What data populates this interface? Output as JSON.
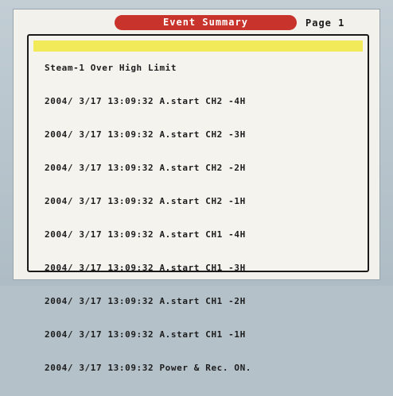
{
  "header": {
    "title": "Event Summary",
    "page_label": "Page 1"
  },
  "events": {
    "highlighted": "Steam-1 Over High Limit",
    "rows": [
      "2004/ 3/17 13:09:32 A.start CH2 -4H",
      "2004/ 3/17 13:09:32 A.start CH2 -3H",
      "2004/ 3/17 13:09:32 A.start CH2 -2H",
      "2004/ 3/17 13:09:32 A.start CH2 -1H",
      "2004/ 3/17 13:09:32 A.start CH1 -4H",
      "2004/ 3/17 13:09:32 A.start CH1 -3H",
      "2004/ 3/17 13:09:32 A.start CH1 -2H",
      "2004/ 3/17 13:09:32 A.start CH1 -1H",
      "2004/ 3/17 13:09:32 Power & Rec. ON."
    ]
  },
  "colors": {
    "title_pill": "#c8332b",
    "highlight": "#f3ea5a",
    "screen": "#f2f1ec",
    "bezel": "#b4c1c9"
  }
}
